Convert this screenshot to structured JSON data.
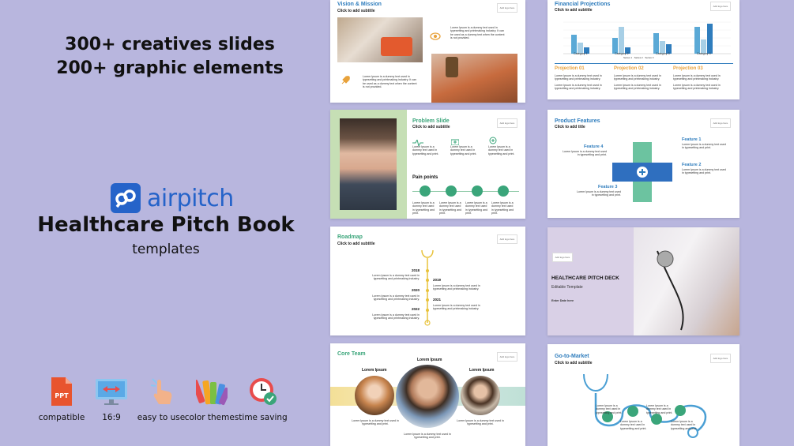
{
  "promo": {
    "line1": "300+ creatives slides",
    "line2": "200+ graphic elements",
    "brand_a": "air",
    "brand_b": "pitch",
    "title": "Healthcare Pitch Book",
    "subtitle": "templates"
  },
  "features": [
    {
      "icon": "ppt-icon",
      "label": "compatible"
    },
    {
      "icon": "monitor-ratio-icon",
      "label": "16:9"
    },
    {
      "icon": "hand-tap-icon",
      "label": "easy to use"
    },
    {
      "icon": "color-swatch-icon",
      "label": "color themes"
    },
    {
      "icon": "clock-check-icon",
      "label": "time saving"
    }
  ],
  "ppt_label": "PPT",
  "common": {
    "logo": "Add logo here",
    "click_subtitle": "Click to add subtitle",
    "click_title": "Click to add title",
    "lorem_short": "Lorem Ipsum is a dummy text used in typesetting and printmaking industry.",
    "lorem_long": "Lorem Ipsum is a dummy text used in typesetting and printmaking industry. It can be used as a dummy text when the content is not provided.",
    "lorem_print": "Lorem Ipsum is a dummy text used in typesetting and print."
  },
  "slide_vision": {
    "title": "Vision & Mission"
  },
  "slide_financial": {
    "title": "Financial Projections",
    "categories": [
      "Category 1",
      "Category 2",
      "Category 3",
      "Category 4"
    ],
    "legend": [
      "Series 1",
      "Series 2",
      "Series 3"
    ],
    "projections": [
      "Projection 01",
      "Projection 02",
      "Projection 03"
    ]
  },
  "slide_problem": {
    "title": "Problem Slide",
    "pain_points": "Pain points"
  },
  "slide_features": {
    "title": "Product Features",
    "f1": "Feature 1",
    "f2": "Feature 2",
    "f3": "Feature 3",
    "f4": "Feature 4"
  },
  "slide_roadmap": {
    "title": "Roadmap",
    "years": [
      "2018",
      "2019",
      "2020",
      "2021",
      "2022"
    ]
  },
  "slide_deck": {
    "title": "HEALTHCARE PITCH DECK",
    "editable": "Editable Template",
    "date": "Enter Date here"
  },
  "slide_team": {
    "title": "Core Team",
    "name": "Lorem Ipsum"
  },
  "slide_gtm": {
    "title": "Go-to-Market"
  },
  "colors": {
    "background": "#b8b6de",
    "brand_blue": "#2563c9",
    "accent_green": "#3aa57a",
    "accent_orange": "#e8a23b",
    "accent_blue": "#2f7dbd"
  }
}
